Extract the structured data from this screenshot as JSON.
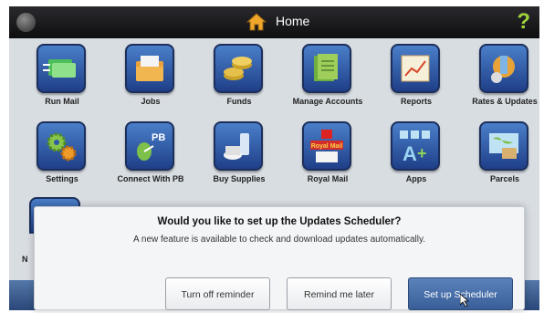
{
  "header": {
    "title": "Home",
    "help_label": "?"
  },
  "tiles": [
    {
      "label": "Run Mail",
      "icon": "run-mail-icon"
    },
    {
      "label": "Jobs",
      "icon": "jobs-icon"
    },
    {
      "label": "Funds",
      "icon": "funds-icon"
    },
    {
      "label": "Manage Accounts",
      "icon": "manage-accounts-icon"
    },
    {
      "label": "Reports",
      "icon": "reports-icon"
    },
    {
      "label": "Rates & Updates",
      "icon": "rates-updates-icon"
    },
    {
      "label": "Settings",
      "icon": "settings-icon"
    },
    {
      "label": "Connect With PB",
      "icon": "connect-pb-icon"
    },
    {
      "label": "Buy Supplies",
      "icon": "buy-supplies-icon"
    },
    {
      "label": "Royal Mail",
      "icon": "royal-mail-icon"
    },
    {
      "label": "Apps",
      "icon": "apps-icon"
    },
    {
      "label": "Parcels",
      "icon": "parcels-icon"
    }
  ],
  "partial_tile_label": "N",
  "icon_text": {
    "pb": "PB",
    "royal_mail": "Royal Mail"
  },
  "dialog": {
    "title": "Would you like to set up the Updates Scheduler?",
    "message": "A new feature is available to check and download updates automatically.",
    "buttons": {
      "turn_off": "Turn off reminder",
      "remind_later": "Remind me later",
      "setup": "Set up Scheduler"
    }
  },
  "colors": {
    "help": "#9fd23a",
    "tile_blue": "#2d5aa8",
    "primary_button": "#4a6fa8"
  }
}
